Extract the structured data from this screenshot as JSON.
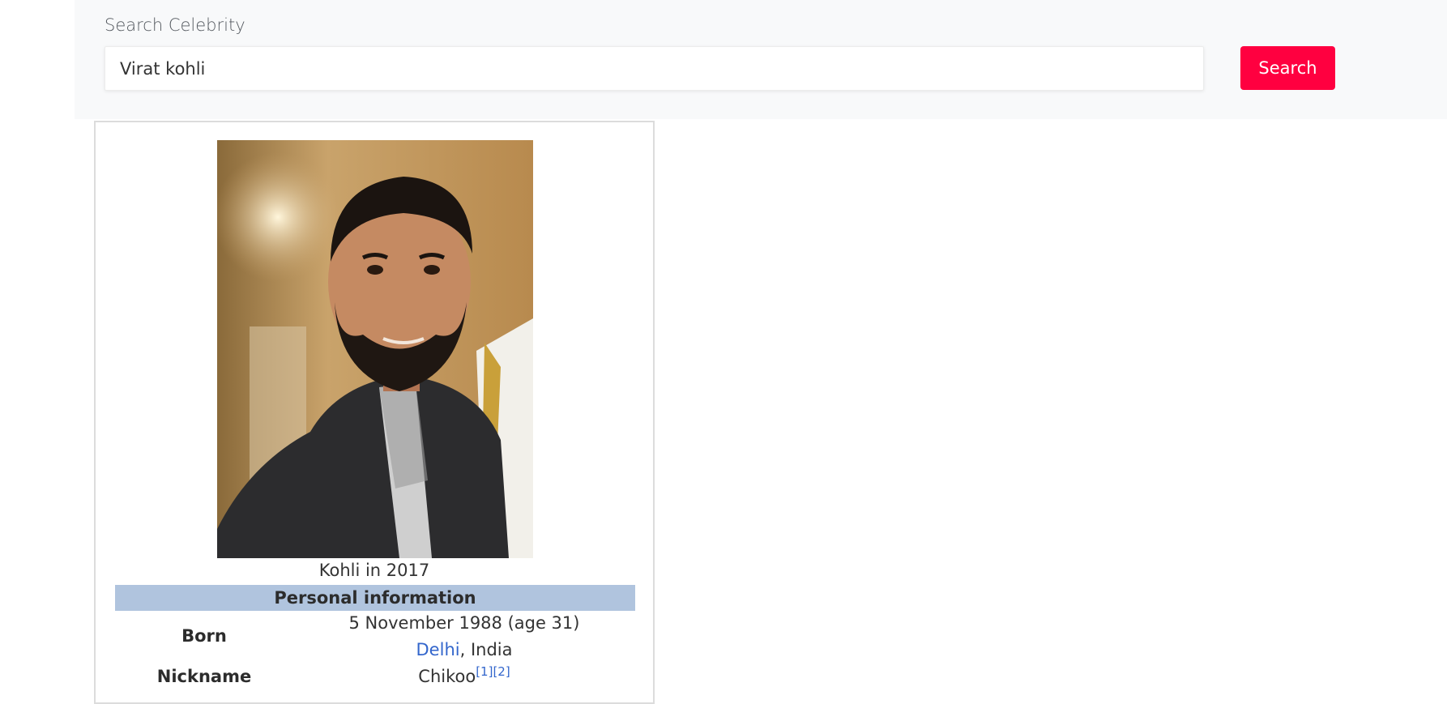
{
  "search": {
    "label": "Search Celebrity",
    "value": "Virat kohli",
    "button_label": "Search"
  },
  "infobox": {
    "caption": "Kohli in 2017",
    "section_title": "Personal information",
    "born": {
      "label": "Born",
      "date": "5 November 1988 (age 31)",
      "place_link": "Delhi",
      "place_rest": ", India"
    },
    "nickname": {
      "label": "Nickname",
      "value": "Chikoo",
      "ref1": "[1]",
      "ref2": "[2]"
    }
  },
  "colors": {
    "search_button": "#ff0040",
    "section_header": "#b0c4de",
    "link": "#3366cc",
    "panel_background": "#f8f9fa"
  }
}
